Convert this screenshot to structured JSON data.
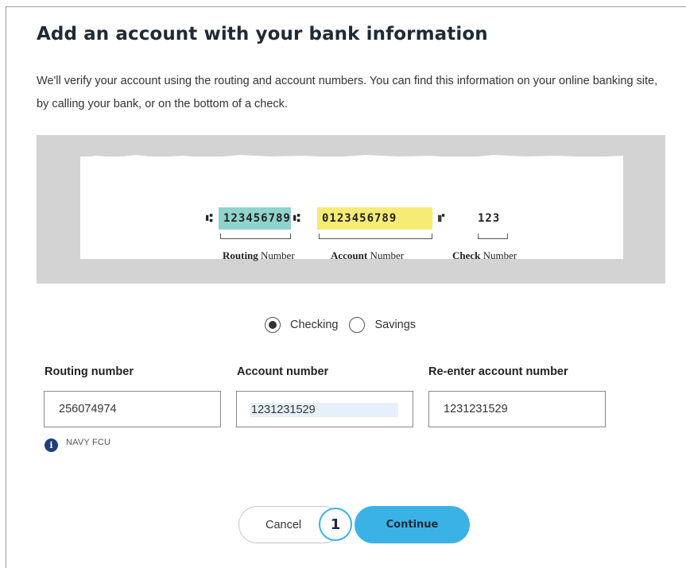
{
  "header": {
    "title": "Add an account with your bank information",
    "description": "We'll verify your account using the routing and account numbers. You can find this information on your online banking site, by calling your bank, or on the bottom of a check."
  },
  "check_image": {
    "routing_micr": "123456789",
    "account_micr": "0123456789",
    "check_micr": "123",
    "routing_bold": "Routing",
    "account_bold": "Account",
    "check_bold": "Check",
    "number_word": "Number",
    "routing_highlight_color": "#8fd3cc",
    "account_highlight_color": "#f6ec74"
  },
  "account_type": {
    "options": [
      {
        "label": "Checking",
        "selected": true
      },
      {
        "label": "Savings",
        "selected": false
      }
    ]
  },
  "form": {
    "routing": {
      "label": "Routing number",
      "value": "256074974"
    },
    "account": {
      "label": "Account number",
      "value": "1231231529"
    },
    "reenter": {
      "label": "Re-enter account number",
      "value": "1231231529"
    },
    "bank_hint": {
      "icon": "info-icon",
      "text": "NAVY FCU"
    }
  },
  "actions": {
    "cancel_label": "Cancel",
    "continue_label": "Continue",
    "step_badge": "1",
    "accent_color": "#3bb2e6"
  }
}
